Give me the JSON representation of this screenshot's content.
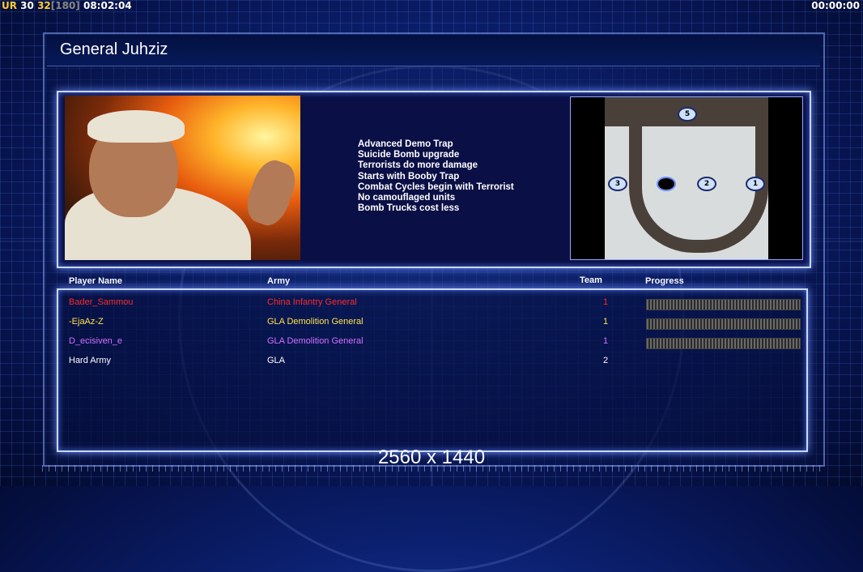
{
  "hud": {
    "ur_label": "UR",
    "ur_value1": "30",
    "ur_value2": "32",
    "ur_value3": "[180]",
    "clock": "08:02:04",
    "timer": "00:00:00"
  },
  "screen": {
    "title": "General Juhziz",
    "resolution": "2560 x 1440"
  },
  "traits": [
    "Advanced Demo Trap",
    "Suicide Bomb upgrade",
    "Terrorists do more damage",
    "Starts with Booby Trap",
    "Combat Cycles begin with Terrorist",
    "No camouflaged units",
    "Bomb Trucks cost less"
  ],
  "map": {
    "markers": [
      "5",
      "3",
      "",
      "2",
      "1"
    ]
  },
  "table": {
    "headers": {
      "player_name": "Player Name",
      "army": "Army",
      "team": "Team",
      "progress": "Progress"
    },
    "players": [
      {
        "name": "Bader_Sammou",
        "army": "China Infantry General",
        "team": "1",
        "color": "#ff2a2a",
        "progress": 1.0
      },
      {
        "name": "-EjaAz-Z",
        "army": "GLA Demolition General",
        "team": "1",
        "color": "#ffe24a",
        "progress": 1.0
      },
      {
        "name": "D_ecisiven_e",
        "army": "GLA Demolition General",
        "team": "1",
        "color": "#d070ff",
        "progress": 1.0
      },
      {
        "name": "Hard Army",
        "army": "GLA",
        "team": "2",
        "color": "#ffffff",
        "progress": null
      }
    ]
  },
  "colors": {
    "accent": "#c9d8ff",
    "background": "#0b1f6e"
  }
}
